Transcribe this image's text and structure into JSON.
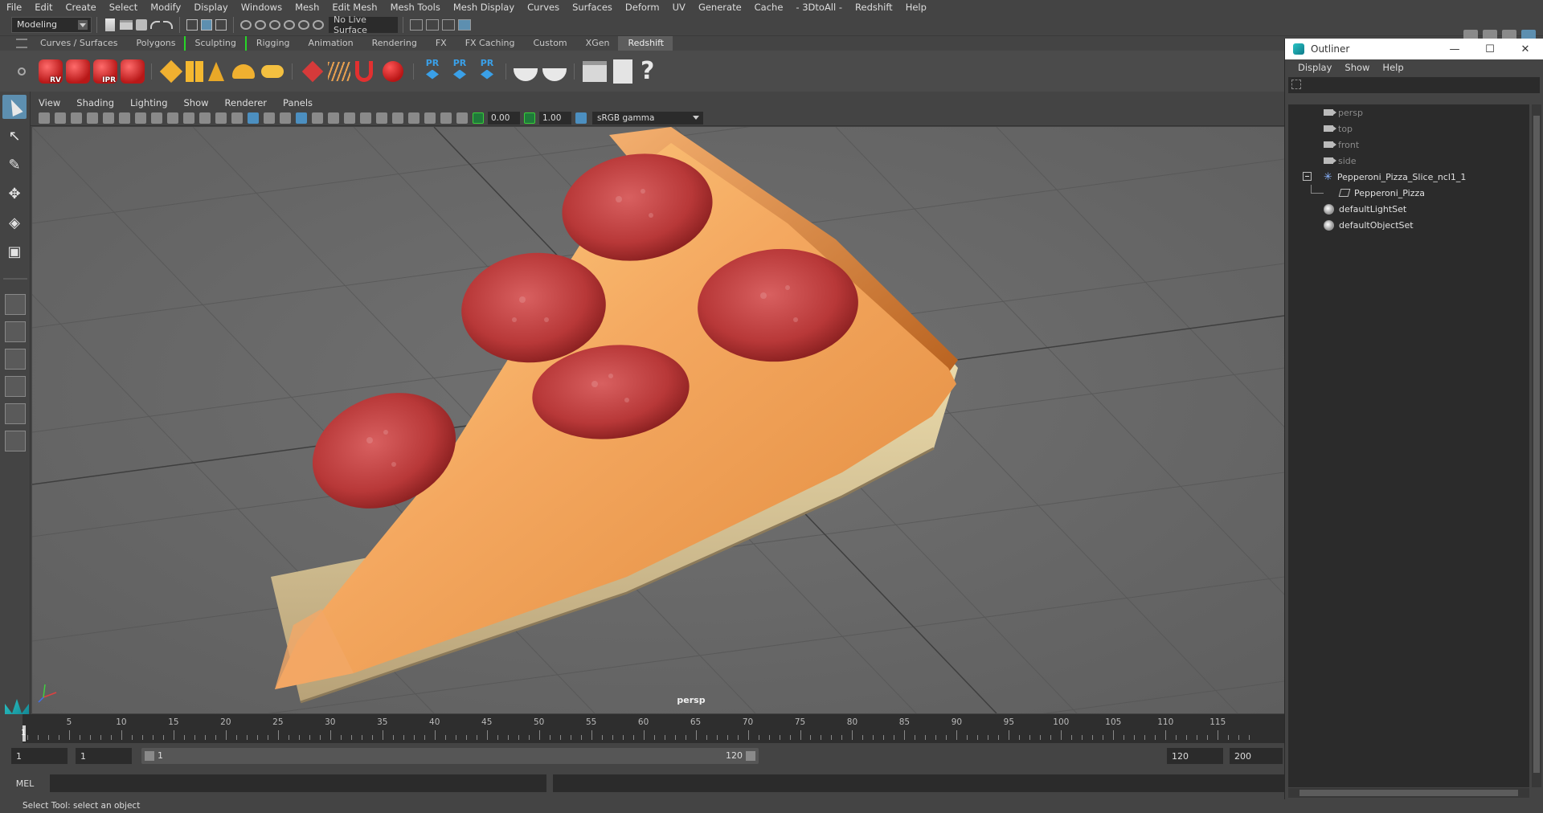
{
  "menubar": {
    "items": [
      "File",
      "Edit",
      "Create",
      "Select",
      "Modify",
      "Display",
      "Windows",
      "Mesh",
      "Edit Mesh",
      "Mesh Tools",
      "Mesh Display",
      "Curves",
      "Surfaces",
      "Deform",
      "UV",
      "Generate",
      "Cache",
      "- 3DtoAll -",
      "Redshift",
      "Help"
    ]
  },
  "statusline": {
    "mode": "Modeling",
    "live_surface": "No Live Surface"
  },
  "shelf": {
    "tabs": [
      "Curves / Surfaces",
      "Polygons",
      "Sculpting",
      "Rigging",
      "Animation",
      "Rendering",
      "FX",
      "FX Caching",
      "Custom",
      "XGen",
      "Redshift"
    ],
    "active_tab": "Redshift",
    "icons": [
      {
        "name": "redshift-render-view-icon",
        "label": "RV"
      },
      {
        "name": "redshift-render-icon",
        "label": ""
      },
      {
        "name": "redshift-ipr-icon",
        "label": "IPR"
      },
      {
        "name": "redshift-settings-icon",
        "label": ""
      },
      {
        "name": "pr-proxy-icon",
        "label": "PR"
      },
      {
        "name": "pr-export-icon",
        "label": "PR"
      },
      {
        "name": "pr-convert-icon",
        "label": "PR"
      }
    ]
  },
  "panel": {
    "menu": [
      "View",
      "Shading",
      "Lighting",
      "Show",
      "Renderer",
      "Panels"
    ],
    "exposure": "0.00",
    "gamma": "1.00",
    "color_space": "sRGB gamma",
    "camera_label": "persp"
  },
  "timeline": {
    "ticks": [
      5,
      10,
      15,
      20,
      25,
      30,
      35,
      40,
      45,
      50,
      55,
      60,
      65,
      70,
      75,
      80,
      85,
      90,
      95,
      100,
      105,
      110,
      115
    ],
    "current_frame": "1"
  },
  "range": {
    "start": "1",
    "current": "1",
    "slider_start": "1",
    "slider_end": "120",
    "anim_end": "120",
    "total_end": "200"
  },
  "cmdline": {
    "label": "MEL"
  },
  "helpline": {
    "text": "Select Tool: select an object"
  },
  "outliner": {
    "title": "Outliner",
    "menu": [
      "Display",
      "Show",
      "Help"
    ],
    "items": [
      {
        "label": "persp",
        "type": "camera",
        "dim": true
      },
      {
        "label": "top",
        "type": "camera",
        "dim": true
      },
      {
        "label": "front",
        "type": "camera",
        "dim": true
      },
      {
        "label": "side",
        "type": "camera",
        "dim": true
      },
      {
        "label": "Pepperoni_Pizza_Slice_ncl1_1",
        "type": "group",
        "dim": false
      },
      {
        "label": "Pepperoni_Pizza",
        "type": "mesh",
        "dim": false
      },
      {
        "label": "defaultLightSet",
        "type": "set",
        "dim": false
      },
      {
        "label": "defaultObjectSet",
        "type": "set",
        "dim": false
      }
    ]
  }
}
